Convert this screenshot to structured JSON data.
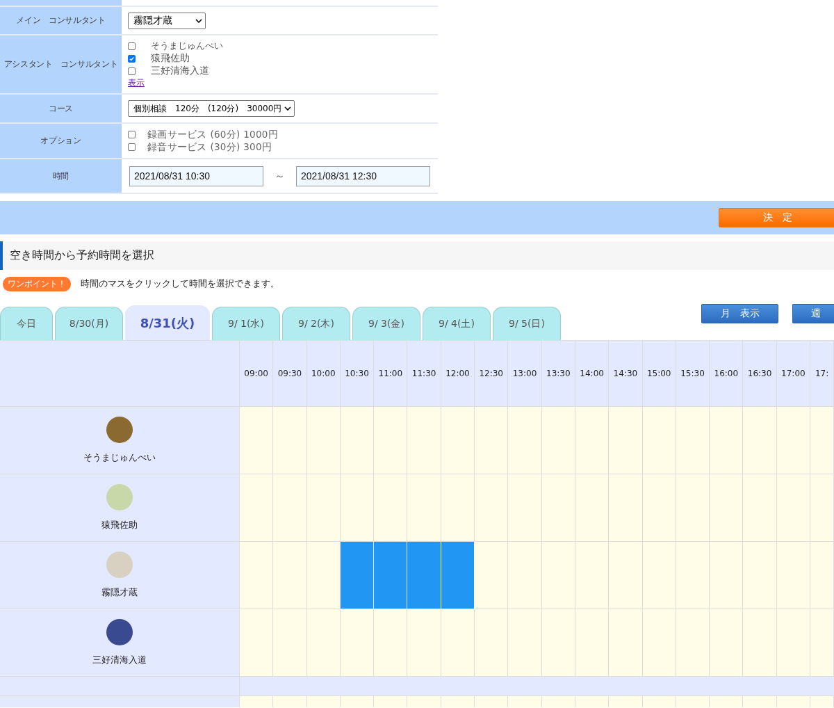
{
  "form": {
    "main_consultant": {
      "label": "メイン　コンサルタント",
      "value": "霧隠才蔵"
    },
    "assistants": {
      "label": "アシスタント　コンサルタント",
      "items": [
        {
          "name": "そうまじゅんぺい",
          "checked": false
        },
        {
          "name": "猿飛佐助",
          "checked": true
        },
        {
          "name": "三好清海入道",
          "checked": false
        }
      ],
      "link": "表示"
    },
    "course": {
      "label": "コース",
      "value": "個別相談　120分　(120分)　30000円"
    },
    "options": {
      "label": "オプション",
      "items": [
        {
          "name": "録画サービス (60分) 1000円",
          "checked": false
        },
        {
          "name": "録音サービス (30分) 300円",
          "checked": false
        }
      ]
    },
    "time": {
      "label": "時間",
      "start": "2021/08/31 10:30",
      "separator": "～",
      "end": "2021/08/31 12:30"
    }
  },
  "submit_button": "決　定",
  "section_title": "空き時間から予約時間を選択",
  "tip": {
    "badge": "ワンポイント！",
    "text": "時間のマスをクリックして時間を選択できます。"
  },
  "tabs": [
    {
      "label": "今日",
      "selected": false
    },
    {
      "label": "8/30(月)",
      "selected": false
    },
    {
      "label": "8/31(火)",
      "selected": true
    },
    {
      "label": "9/ 1(水)",
      "selected": false
    },
    {
      "label": "9/ 2(木)",
      "selected": false
    },
    {
      "label": "9/ 3(金)",
      "selected": false
    },
    {
      "label": "9/ 4(土)",
      "selected": false
    },
    {
      "label": "9/ 5(日)",
      "selected": false
    }
  ],
  "view_buttons": [
    "月　表示",
    "週"
  ],
  "schedule": {
    "times": [
      "09:00",
      "09:30",
      "10:00",
      "10:30",
      "11:00",
      "11:30",
      "12:00",
      "12:30",
      "13:00",
      "13:30",
      "14:00",
      "14:30",
      "15:00",
      "15:30",
      "16:00",
      "16:30",
      "17:00",
      "17:"
    ],
    "rows": [
      {
        "name": "そうまじゅんぺい",
        "slots": [
          false,
          false,
          false,
          false,
          false,
          false,
          false,
          false,
          false,
          false,
          false,
          false,
          false,
          false,
          false,
          false,
          false,
          false
        ]
      },
      {
        "name": "猿飛佐助",
        "slots": [
          false,
          false,
          false,
          false,
          false,
          false,
          false,
          false,
          false,
          false,
          false,
          false,
          false,
          false,
          false,
          false,
          false,
          false
        ]
      },
      {
        "name": "霧隠才蔵",
        "slots": [
          false,
          false,
          false,
          true,
          true,
          true,
          true,
          false,
          false,
          false,
          false,
          false,
          false,
          false,
          false,
          false,
          false,
          false
        ]
      },
      {
        "name": "三好清海入道",
        "slots": [
          false,
          false,
          false,
          false,
          false,
          false,
          false,
          false,
          false,
          false,
          false,
          false,
          false,
          false,
          false,
          false,
          false,
          false
        ]
      }
    ]
  }
}
